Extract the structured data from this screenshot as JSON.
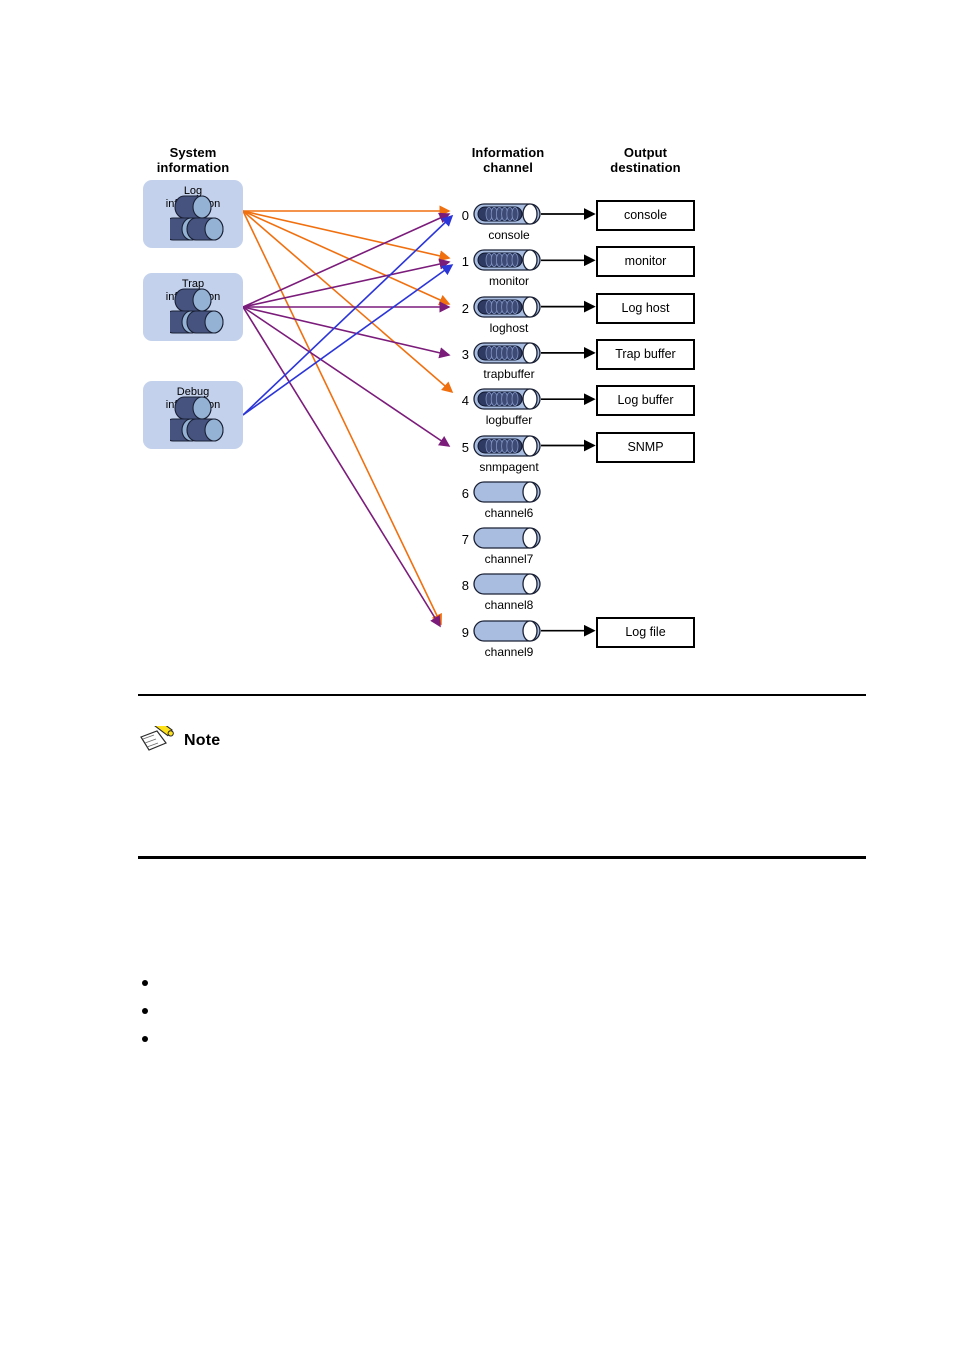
{
  "diagram": {
    "headers": {
      "system": "System\ninformation",
      "channel": "Information\nchannel",
      "destination": "Output\ndestination"
    },
    "sources": [
      {
        "label": "Log\ninformation",
        "color": "#F07010",
        "icon": "database-stack-icon"
      },
      {
        "label": "Trap\ninformation",
        "color": "#7B1C7B",
        "icon": "database-stack-icon"
      },
      {
        "label": "Debug\ninformation",
        "color": "#2B35D8",
        "icon": "database-stack-icon"
      }
    ],
    "channels": [
      {
        "num": "0",
        "name": "console",
        "configured": true,
        "destination": "console"
      },
      {
        "num": "1",
        "name": "monitor",
        "configured": true,
        "destination": "monitor"
      },
      {
        "num": "2",
        "name": "loghost",
        "configured": true,
        "destination": "Log host"
      },
      {
        "num": "3",
        "name": "trapbuffer",
        "configured": true,
        "destination": "Trap buffer"
      },
      {
        "num": "4",
        "name": "logbuffer",
        "configured": true,
        "destination": "Log buffer"
      },
      {
        "num": "5",
        "name": "snmpagent",
        "configured": true,
        "destination": "SNMP"
      },
      {
        "num": "6",
        "name": "channel6",
        "configured": false,
        "destination": ""
      },
      {
        "num": "7",
        "name": "channel7",
        "configured": false,
        "destination": ""
      },
      {
        "num": "8",
        "name": "channel8",
        "configured": false,
        "destination": ""
      },
      {
        "num": "9",
        "name": "channel9",
        "configured": false,
        "destination": "Log file"
      }
    ],
    "colors": {
      "log_arrow": "#F07010",
      "trap_arrow": "#7B1C7B",
      "debug_arrow": "#2B35D8",
      "source_box": "#c3d1ec",
      "cylinder_body": "#a8bde0",
      "cylinder_core": "#2e3a61",
      "barrel_body": "#46537f",
      "barrel_face": "#93b2d4"
    },
    "connections": [
      {
        "from": "Log information",
        "to_channels": [
          "0",
          "1",
          "2",
          "4",
          "9"
        ]
      },
      {
        "from": "Trap information",
        "to_channels": [
          "0",
          "1",
          "2",
          "3",
          "5",
          "9"
        ]
      },
      {
        "from": "Debug information",
        "to_channels": [
          "0",
          "1"
        ]
      }
    ]
  },
  "note": {
    "icon": "note-pencil-icon",
    "title": "Note",
    "body": ""
  },
  "bullets": [
    {
      "text": ""
    },
    {
      "text": ""
    },
    {
      "text": ""
    }
  ]
}
